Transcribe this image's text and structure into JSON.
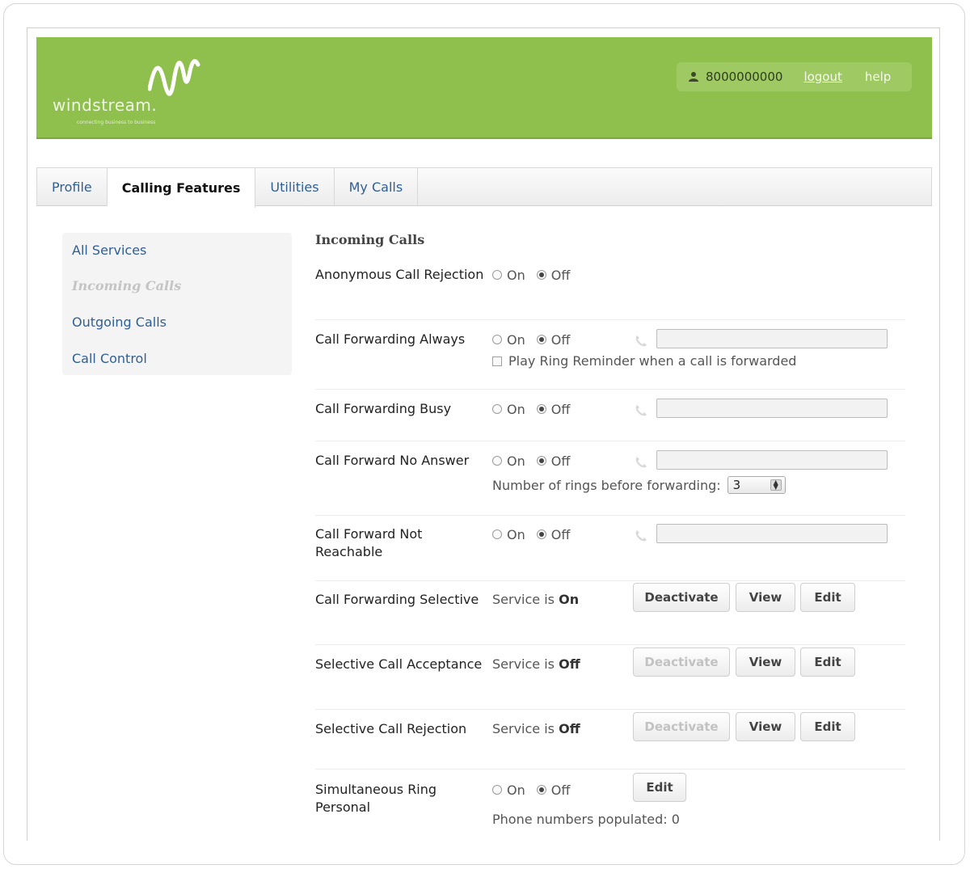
{
  "brand": {
    "name": "windstream.",
    "tagline": "connecting business to business",
    "header_color": "#8fbf4d"
  },
  "user": {
    "phone": "8000000000",
    "logout_label": "logout",
    "help_label": "help"
  },
  "tabs": [
    {
      "label": "Profile",
      "active": false
    },
    {
      "label": "Calling Features",
      "active": true
    },
    {
      "label": "Utilities",
      "active": false
    },
    {
      "label": "My Calls",
      "active": false
    }
  ],
  "sidebar": {
    "items": [
      {
        "label": "All Services",
        "current": false
      },
      {
        "label": "Incoming Calls",
        "current": true
      },
      {
        "label": "Outgoing Calls",
        "current": false
      },
      {
        "label": "Call Control",
        "current": false
      }
    ]
  },
  "main": {
    "section_title": "Incoming Calls",
    "radio_on_label": "On",
    "radio_off_label": "Off",
    "features": {
      "anonymous_rejection": {
        "label": "Anonymous Call Rejection",
        "state": "Off"
      },
      "cf_always": {
        "label": "Call Forwarding Always",
        "state": "Off",
        "phone_value": "",
        "ring_reminder_label": "Play Ring Reminder when a call is forwarded",
        "ring_reminder_checked": false
      },
      "cf_busy": {
        "label": "Call Forwarding Busy",
        "state": "Off",
        "phone_value": ""
      },
      "cf_no_answer": {
        "label": "Call Forward No Answer",
        "state": "Off",
        "phone_value": "",
        "rings_label": "Number of rings before forwarding:",
        "rings_value": "3"
      },
      "cf_not_reachable": {
        "label": "Call Forward Not Reachable",
        "state": "Off",
        "phone_value": ""
      },
      "cf_selective": {
        "label": "Call Forwarding Selective",
        "status_prefix": "Service is",
        "status_value": "On",
        "deactivate_label": "Deactivate",
        "deactivate_enabled": true,
        "view_label": "View",
        "edit_label": "Edit"
      },
      "selective_acceptance": {
        "label": "Selective Call Acceptance",
        "status_prefix": "Service is",
        "status_value": "Off",
        "deactivate_label": "Deactivate",
        "deactivate_enabled": false,
        "view_label": "View",
        "edit_label": "Edit"
      },
      "selective_rejection": {
        "label": "Selective Call Rejection",
        "status_prefix": "Service is",
        "status_value": "Off",
        "deactivate_label": "Deactivate",
        "deactivate_enabled": false,
        "view_label": "View",
        "edit_label": "Edit"
      },
      "simring_personal": {
        "label": "Simultaneous Ring Personal",
        "state": "Off",
        "edit_label": "Edit",
        "populated_label": "Phone numbers populated: 0"
      }
    }
  }
}
